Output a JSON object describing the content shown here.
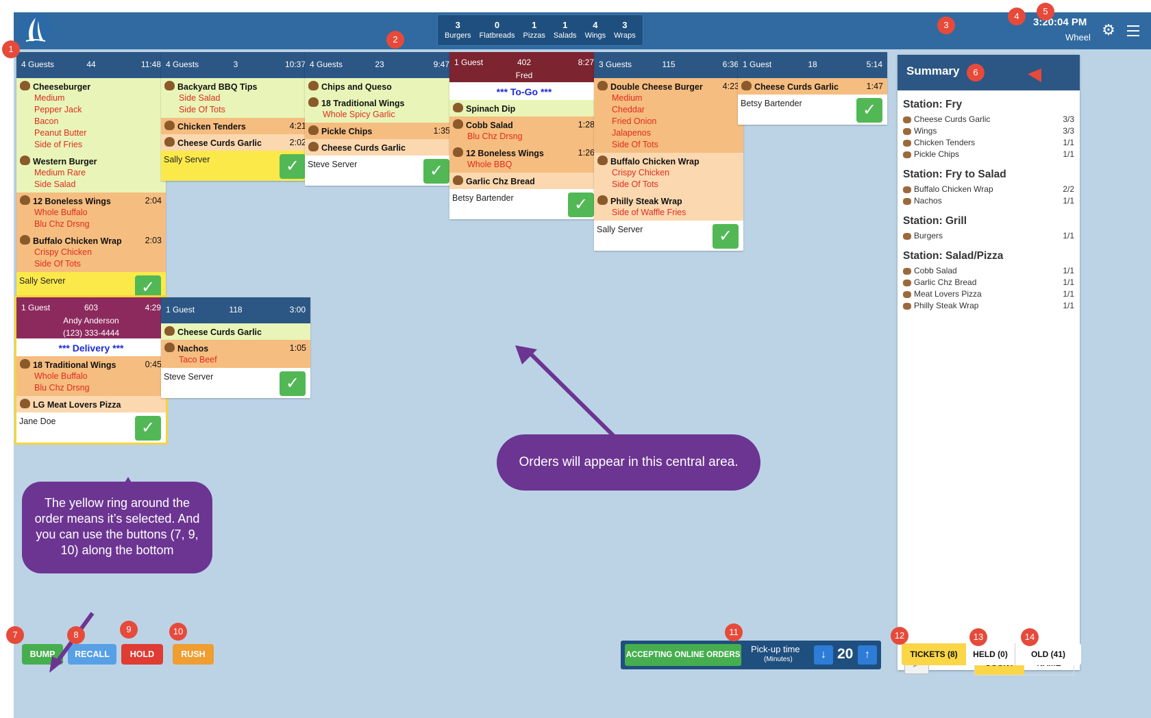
{
  "header": {
    "counts": [
      {
        "num": "3",
        "label": "Burgers"
      },
      {
        "num": "0",
        "label": "Flatbreads"
      },
      {
        "num": "1",
        "label": "Pizzas"
      },
      {
        "num": "1",
        "label": "Salads"
      },
      {
        "num": "4",
        "label": "Wings"
      },
      {
        "num": "3",
        "label": "Wraps"
      }
    ],
    "clock": "3:20:04 PM",
    "station": "Wheel"
  },
  "tickets": [
    {
      "guests": "4 Guests",
      "number": "44",
      "time": "11:48",
      "server": "Sally Server",
      "items": [
        {
          "name": "Cheeseburger",
          "time": "",
          "mods": [
            "Medium",
            "Pepper Jack",
            "Bacon",
            "Peanut Butter",
            "Side of Fries"
          ]
        },
        {
          "name": "Western Burger",
          "time": "",
          "mods": [
            "Medium Rare",
            "Side Salad"
          ]
        },
        {
          "name": "12 Boneless Wings",
          "time": "2:04",
          "mods": [
            "Whole Buffalo",
            "Blu Chz Drsng"
          ]
        },
        {
          "name": "Buffalo Chicken Wrap",
          "time": "2:03",
          "mods": [
            "Crispy Chicken",
            "Side Of Tots"
          ]
        }
      ]
    },
    {
      "guests": "4 Guests",
      "number": "3",
      "time": "10:37",
      "server": "Sally Server",
      "items": [
        {
          "name": "Backyard BBQ Tips",
          "time": "",
          "mods": [
            "Side Salad",
            "Side Of Tots"
          ]
        },
        {
          "name": "Chicken Tenders",
          "time": "4:21",
          "mods": []
        },
        {
          "name": "Cheese Curds Garlic",
          "time": "2:02",
          "mods": []
        }
      ]
    },
    {
      "guests": "4 Guests",
      "number": "23",
      "time": "9:47",
      "server": "Steve Server",
      "items": [
        {
          "name": "Chips and Queso",
          "time": "",
          "mods": []
        },
        {
          "name": "18 Traditional Wings",
          "time": "",
          "mods": [
            "Whole Spicy Garlic"
          ]
        },
        {
          "name": "Pickle Chips",
          "time": "1:35",
          "mods": []
        },
        {
          "name": "Cheese Curds Garlic",
          "time": "",
          "mods": []
        }
      ]
    },
    {
      "guests": "1 Guest",
      "number": "402",
      "time": "8:27",
      "customer": "Fred",
      "banner": "*** To-Go ***",
      "server": "Betsy Bartender",
      "items": [
        {
          "name": "Spinach Dip",
          "time": "",
          "mods": []
        },
        {
          "name": "Cobb Salad",
          "time": "1:28",
          "mods": [
            "Blu Chz Drsng"
          ]
        },
        {
          "name": "12 Boneless Wings",
          "time": "1:26",
          "mods": [
            "Whole BBQ"
          ]
        },
        {
          "name": "Garlic Chz Bread",
          "time": "",
          "mods": []
        }
      ]
    },
    {
      "guests": "3 Guests",
      "number": "115",
      "time": "6:36",
      "server": "Sally Server",
      "items": [
        {
          "name": "Double Cheese Burger",
          "time": "4:23",
          "mods": [
            "Medium",
            "Cheddar",
            "Fried Onion",
            "Jalapenos",
            "Side Of Tots"
          ]
        },
        {
          "name": "Buffalo Chicken Wrap",
          "time": "",
          "mods": [
            "Crispy Chicken",
            "Side Of Tots"
          ]
        },
        {
          "name": "Philly Steak Wrap",
          "time": "",
          "mods": [
            "Side of Waffle Fries"
          ]
        }
      ]
    },
    {
      "guests": "1 Guest",
      "number": "18",
      "time": "5:14",
      "server": "Betsy Bartender",
      "items": [
        {
          "name": "Cheese Curds Garlic",
          "time": "1:47",
          "mods": []
        }
      ]
    },
    {
      "guests": "1 Guest",
      "number": "603",
      "time": "4:29",
      "customer": "Andy Anderson",
      "phone": "(123) 333-4444",
      "banner": "*** Delivery ***",
      "server": "Jane Doe",
      "items": [
        {
          "name": "18 Traditional Wings",
          "time": "0:45",
          "mods": [
            "Whole Buffalo",
            "Blu Chz Drsng"
          ]
        },
        {
          "name": "LG Meat Lovers Pizza",
          "time": "",
          "mods": []
        }
      ]
    },
    {
      "guests": "1 Guest",
      "number": "118",
      "time": "3:00",
      "server": "Steve Server",
      "items": [
        {
          "name": "Cheese Curds Garlic",
          "time": "",
          "mods": []
        },
        {
          "name": "Nachos",
          "time": "1:05",
          "mods": [
            "Taco Beef"
          ]
        }
      ]
    }
  ],
  "summary": {
    "title": "Summary",
    "stations": [
      {
        "name": "Station: Fry",
        "items": [
          {
            "name": "Cheese Curds Garlic",
            "count": "3/3"
          },
          {
            "name": "Wings",
            "count": "3/3"
          },
          {
            "name": "Chicken Tenders",
            "count": "1/1"
          },
          {
            "name": "Pickle Chips",
            "count": "1/1"
          }
        ]
      },
      {
        "name": "Station: Fry to Salad",
        "items": [
          {
            "name": "Buffalo Chicken Wrap",
            "count": "2/2"
          },
          {
            "name": "Nachos",
            "count": "1/1"
          }
        ]
      },
      {
        "name": "Station: Grill",
        "items": [
          {
            "name": "Burgers",
            "count": "1/1"
          }
        ]
      },
      {
        "name": "Station: Salad/Pizza",
        "items": [
          {
            "name": "Cobb Salad",
            "count": "1/1"
          },
          {
            "name": "Garlic Chz Bread",
            "count": "1/1"
          },
          {
            "name": "Meat Lovers Pizza",
            "count": "1/1"
          },
          {
            "name": "Philly Steak Wrap",
            "count": "1/1"
          }
        ]
      }
    ],
    "sort_count": "COUNT",
    "sort_name": "NAME"
  },
  "bottom": {
    "bump": "BUMP",
    "recall": "RECALL",
    "hold": "HOLD",
    "rush": "RUSH",
    "online": "ACCEPTING ONLINE ORDERS",
    "pickup_label": "Pick-up time",
    "pickup_sub": "(Minutes)",
    "pickup_value": "20",
    "tickets_tab": "TICKETS (8)",
    "held_tab": "HELD (0)",
    "old_tab": "OLD (41)"
  },
  "callouts": {
    "central": "Orders will appear in this central area.",
    "selected": "The yellow ring around the order means it’s selected. And you can use the buttons (7, 9, 10) along the bottom"
  },
  "badges": [
    "1",
    "2",
    "3",
    "4",
    "5",
    "6",
    "7",
    "8",
    "9",
    "10",
    "11",
    "12",
    "13",
    "14"
  ]
}
